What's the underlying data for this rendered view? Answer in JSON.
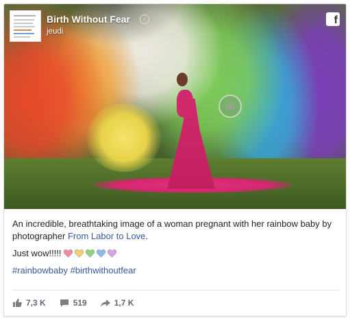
{
  "page": {
    "name": "Birth Without Fear",
    "date": "jeudi",
    "avatar_caption": "FOR YOUR FRAME ®"
  },
  "post": {
    "caption_text": "An incredible, breathtaking image of a woman pregnant with her rainbow baby by photographer ",
    "caption_link": "From Labor to Love",
    "caption_end": ".",
    "wow_text": "Just wow!!!!!",
    "hearts": [
      "#f28aa0",
      "#f4d26a",
      "#8fd47a",
      "#8eb8e8",
      "#d7a2e6"
    ],
    "hashtags": [
      "#rainbowbaby",
      "#birthwithoutfear"
    ]
  },
  "stats": {
    "likes": "7,3 K",
    "comments": "519",
    "shares": "1,7 K"
  },
  "colors": {
    "link": "#365899",
    "stat": "#616770",
    "text": "#1d2129"
  }
}
